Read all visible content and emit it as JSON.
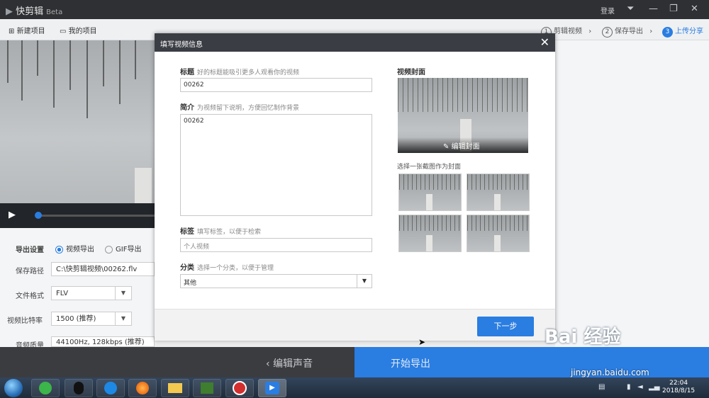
{
  "app": {
    "name": "快剪辑",
    "badge": "Beta",
    "login": "登录"
  },
  "toolbar": {
    "new_project": "新建项目",
    "my_projects": "我的项目",
    "steps": [
      {
        "num": "1",
        "label": "剪辑视频"
      },
      {
        "num": "2",
        "label": "保存导出"
      },
      {
        "num": "3",
        "label": "上传分享"
      }
    ]
  },
  "settings": {
    "export_label": "导出设置",
    "video_export": "视频导出",
    "gif_export": "GIF导出",
    "save_path_label": "保存路径",
    "save_path_value": "C:\\快剪辑视频\\00262.flv",
    "format_label": "文件格式",
    "format_value": "FLV",
    "bitrate_label": "视频比特率",
    "bitrate_value": "1500 (推荐)",
    "audio_label": "音频质量",
    "audio_value": "44100Hz, 128kbps (推荐)"
  },
  "bottom": {
    "edit_audio": "编辑声音",
    "start_export": "开始导出"
  },
  "dialog": {
    "title": "填写视频信息",
    "title_label": "标题",
    "title_hint": "好的标题能吸引更多人观看你的视频",
    "title_value": "00262",
    "intro_label": "简介",
    "intro_hint": "为视频留下说明，方便回忆制作背景",
    "intro_value": "00262",
    "tags_label": "标签",
    "tags_hint": "填写标签，以便于检索",
    "tags_placeholder": "个人视频",
    "category_label": "分类",
    "category_hint": "选择一个分类，以便于管理",
    "category_value": "其他",
    "cover_label": "视频封面",
    "edit_cover": "编辑封面",
    "choose_cover": "选择一张截图作为封面",
    "next_button": "下一步"
  },
  "taskbar": {
    "time": "22:04",
    "date": "2018/8/15"
  },
  "watermark": {
    "logo": "Bai 经验",
    "url": "jingyan.baidu.com"
  },
  "colors": {
    "accent": "#2a7de1",
    "titlebar": "#2f3033"
  }
}
